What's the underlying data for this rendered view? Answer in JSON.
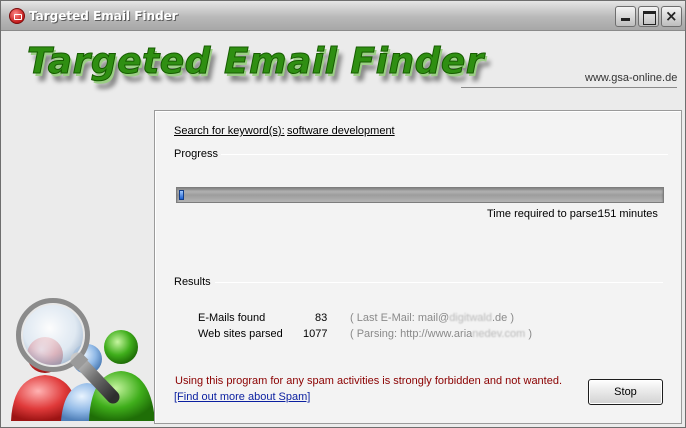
{
  "window": {
    "title": "Targeted Email Finder"
  },
  "banner": {
    "title": "Targeted Email Finder",
    "url": "www.gsa-online.de"
  },
  "search": {
    "label": "Search for keyword(s):",
    "keyword": "software development"
  },
  "progress": {
    "label": "Progress",
    "fraction": 0.01,
    "time_label": "Time required to parse:",
    "time_value": "151 minutes"
  },
  "results": {
    "label": "Results",
    "emails_label": "E-Mails found",
    "emails_count": "83",
    "last_email_prefix": "( Last E-Mail: mail@",
    "last_email_obscured": "digitwald",
    "last_email_suffix": ".de )",
    "sites_label": "Web sites parsed",
    "sites_count": "1077",
    "parsing_prefix": "( Parsing: http://www.aria",
    "parsing_obscured": "nedev.com",
    "parsing_suffix": " )"
  },
  "footer": {
    "warning": "Using this program for any spam activities is strongly forbidden and not wanted.",
    "link": "[Find out more about Spam]"
  },
  "buttons": {
    "stop": "Stop"
  },
  "colors": {
    "brand_green": "#2f8f12",
    "warning_red": "#8b0000",
    "link_blue": "#0a1fa0",
    "progress_blue": "#1c5fd0"
  }
}
